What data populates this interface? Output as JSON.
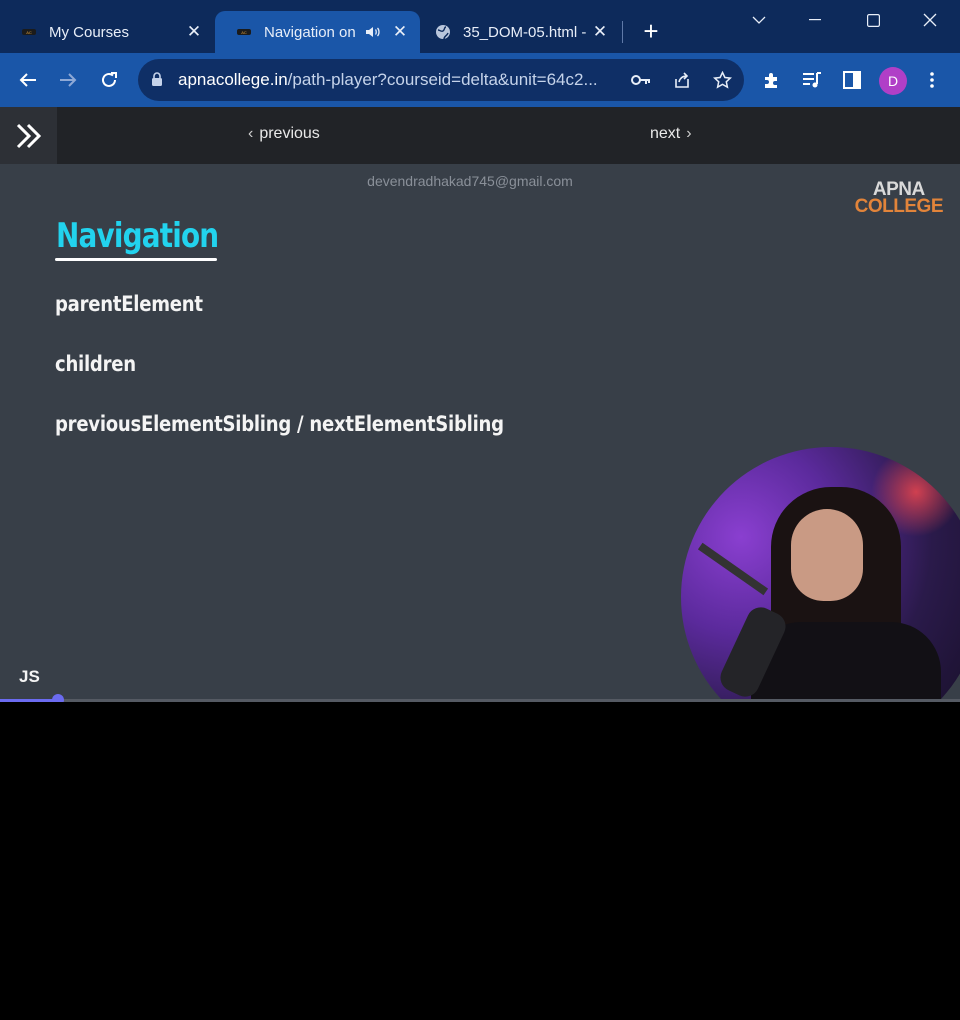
{
  "browser": {
    "tabs": [
      {
        "title": "My Courses",
        "active": false
      },
      {
        "title": "Navigation on",
        "active": true,
        "audio": "speaker-icon"
      },
      {
        "title": "35_DOM-05.html -",
        "active": false
      }
    ],
    "url_host": "apnacollege.in",
    "url_path": "/path-player?courseid=delta&unit=64c2...",
    "profile_initial": "D",
    "colors": {
      "tabstrip": "#0d2a5b",
      "toolbar": "#1a56a8",
      "avatar": "#b03fc7"
    }
  },
  "page": {
    "nav": {
      "previous": "previous",
      "next": "next"
    },
    "watermark": "devendradhakad745@gmail.com",
    "logo_line1": "APNA",
    "logo_line2": "COLLEGE",
    "slide": {
      "heading": "Navigation",
      "items": [
        "parentElement",
        "children",
        "previousElementSibling / nextElementSibling"
      ],
      "corner_label": "JS"
    },
    "progress": 0.06,
    "colors": {
      "heading": "#22d3ee",
      "progress": "#6b6bf0",
      "slide_bg": "#383f48"
    }
  }
}
